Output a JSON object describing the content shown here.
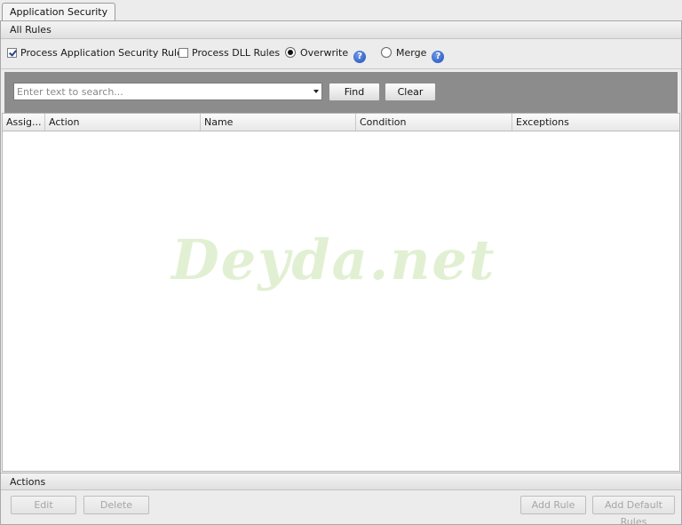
{
  "tab": {
    "label": "Application Security"
  },
  "all_rules": {
    "header": "All Rules"
  },
  "options": {
    "process_app_rules": {
      "label": "Process Application Security Rules",
      "checked": true
    },
    "process_dll_rules": {
      "label": "Process DLL Rules",
      "checked": false
    },
    "overwrite": {
      "label": "Overwrite",
      "selected": true
    },
    "merge": {
      "label": "Merge",
      "selected": false
    },
    "help_glyph": "?"
  },
  "search": {
    "placeholder": "Enter text to search...",
    "value": "",
    "find_label": "Find",
    "clear_label": "Clear"
  },
  "grid": {
    "columns": [
      "Assig...",
      "Action",
      "Name",
      "Condition",
      "Exceptions"
    ],
    "rows": []
  },
  "watermark": "Deyda.net",
  "actions": {
    "header": "Actions",
    "edit_label": "Edit",
    "delete_label": "Delete",
    "add_rule_label": "Add Rule",
    "add_default_rules_label": "Add Default Rules"
  },
  "colors": {
    "search_bar_bg": "#8c8c8c",
    "help_icon": "#1d4fb8",
    "watermark": "#d7ebc4"
  },
  "icons": {
    "checkbox": "checkbox-icon",
    "radio": "radio-icon",
    "help": "help-icon",
    "dropdown": "chevron-down-icon"
  }
}
